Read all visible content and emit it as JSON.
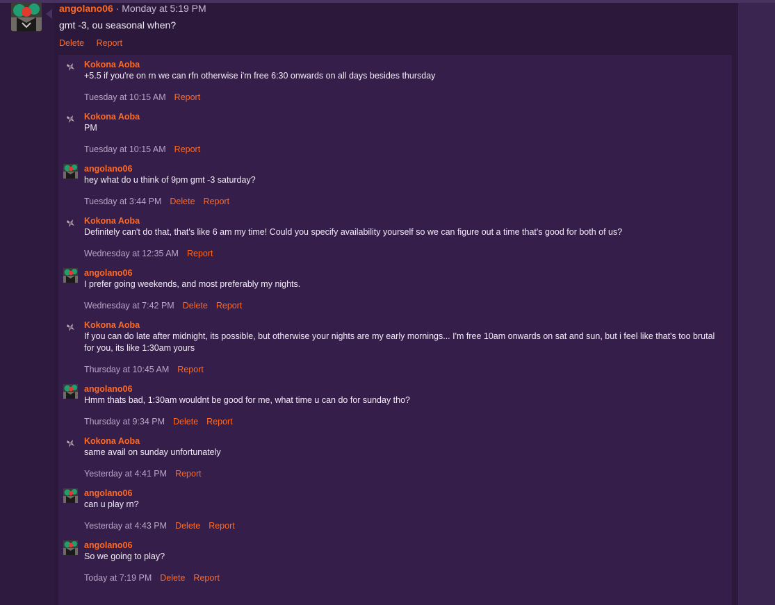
{
  "post": {
    "author": "angolano06",
    "separator": "·",
    "time": "Monday at 5:19 PM",
    "text": "gmt -3, ou seasonal when?",
    "actions": [
      "Delete",
      "Report"
    ]
  },
  "replies": [
    {
      "author": "Kokona Aoba",
      "avatar": "kokona-avatar",
      "text": "+5.5 if you're on rn we can rfn otherwise i'm free 6:30 onwards on all days besides thursday",
      "time": "Tuesday at 10:15 AM",
      "actions": [
        "Report"
      ]
    },
    {
      "author": "Kokona Aoba",
      "avatar": "kokona-avatar",
      "text": "PM",
      "time": "Tuesday at 10:15 AM",
      "actions": [
        "Report"
      ]
    },
    {
      "author": "angolano06",
      "avatar": "angolano-avatar",
      "text": "hey what do u think of 9pm gmt -3 saturday?",
      "time": "Tuesday at 3:44 PM",
      "actions": [
        "Delete",
        "Report"
      ]
    },
    {
      "author": "Kokona Aoba",
      "avatar": "kokona-avatar",
      "text": "Definitely can't do that, that's like 6 am my time! Could you specify availability yourself so we can figure out a time that's good for both of us?",
      "time": "Wednesday at 12:35 AM",
      "actions": [
        "Report"
      ]
    },
    {
      "author": "angolano06",
      "avatar": "angolano-avatar",
      "text": "I prefer going weekends, and most preferably my nights.",
      "time": "Wednesday at 7:42 PM",
      "actions": [
        "Delete",
        "Report"
      ]
    },
    {
      "author": "Kokona Aoba",
      "avatar": "kokona-avatar",
      "text": "If you can do late after midnight, its possible, but otherwise your nights are my early mornings... I'm free 10am onwards on sat and sun, but i feel like that's too brutal for you, its like 1:30am yours",
      "time": "Thursday at 10:45 AM",
      "actions": [
        "Report"
      ]
    },
    {
      "author": "angolano06",
      "avatar": "angolano-avatar",
      "text": "Hmm thats bad, 1:30am wouldnt be good for me, what time u can do for sunday tho?",
      "time": "Thursday at 9:34 PM",
      "actions": [
        "Delete",
        "Report"
      ]
    },
    {
      "author": "Kokona Aoba",
      "avatar": "kokona-avatar",
      "text": "same avail on sunday unfortunately",
      "time": "Yesterday at 4:41 PM",
      "actions": [
        "Report"
      ]
    },
    {
      "author": "angolano06",
      "avatar": "angolano-avatar",
      "text": "can u play rn?",
      "time": "Yesterday at 4:43 PM",
      "actions": [
        "Delete",
        "Report"
      ]
    },
    {
      "author": "angolano06",
      "avatar": "angolano-avatar",
      "text": "So we going to play?",
      "time": "Today at 7:19 PM",
      "actions": [
        "Delete",
        "Report"
      ]
    }
  ]
}
